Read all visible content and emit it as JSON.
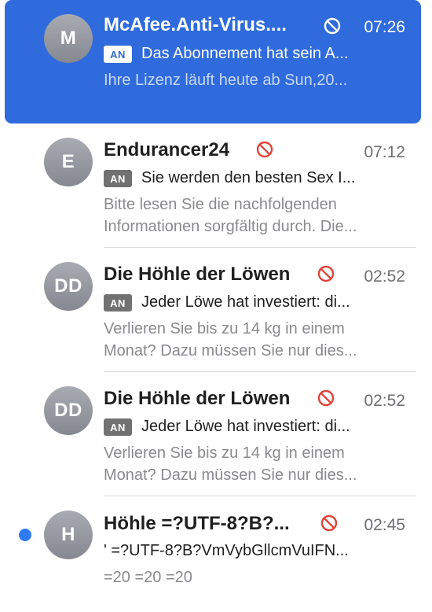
{
  "messages": [
    {
      "avatar": "M",
      "sender": "McAfee.Anti-Virus....",
      "time": "07:26",
      "tag": "AN",
      "subject": "Das Abonnement hat sein A...",
      "preview": [
        "Ihre Lizenz läuft heute ab Sun,20..."
      ],
      "selected": true,
      "blocked_icon": "block-icon"
    },
    {
      "avatar": "E",
      "sender": "Endurancer24",
      "time": "07:12",
      "tag": "AN",
      "subject": "Sie werden den besten Sex I...",
      "preview": [
        "Bitte lesen Sie die nachfolgenden",
        "Informationen sorgfältig durch. Die..."
      ],
      "blocked_icon": "block-icon"
    },
    {
      "avatar": "DD",
      "sender": "Die Höhle der Löwen",
      "time": "02:52",
      "tag": "AN",
      "subject": "Jeder Löwe hat investiert: di...",
      "preview": [
        "Verlieren Sie bis zu 14 kg in einem",
        "Monat? Dazu müssen Sie nur dies..."
      ],
      "blocked_icon": "block-icon"
    },
    {
      "avatar": "DD",
      "sender": "Die Höhle der Löwen",
      "time": "02:52",
      "tag": "AN",
      "subject": "Jeder Löwe hat investiert: di...",
      "preview": [
        "Verlieren Sie bis zu 14 kg in einem",
        "Monat? Dazu müssen Sie nur dies..."
      ],
      "blocked_icon": "block-icon"
    },
    {
      "avatar": "H",
      "sender": "Höhle =?UTF-8?B?...",
      "time": "02:45",
      "subject": "' =?UTF-8?B?VmVybGllcmVuIFN...",
      "preview": [
        "=20 =20 =20"
      ],
      "unread": true,
      "blocked_icon": "block-icon"
    }
  ],
  "colors": {
    "selection": "#2f6bdc",
    "unread_dot": "#2f7bf5",
    "block_icon": "#e0443a"
  }
}
